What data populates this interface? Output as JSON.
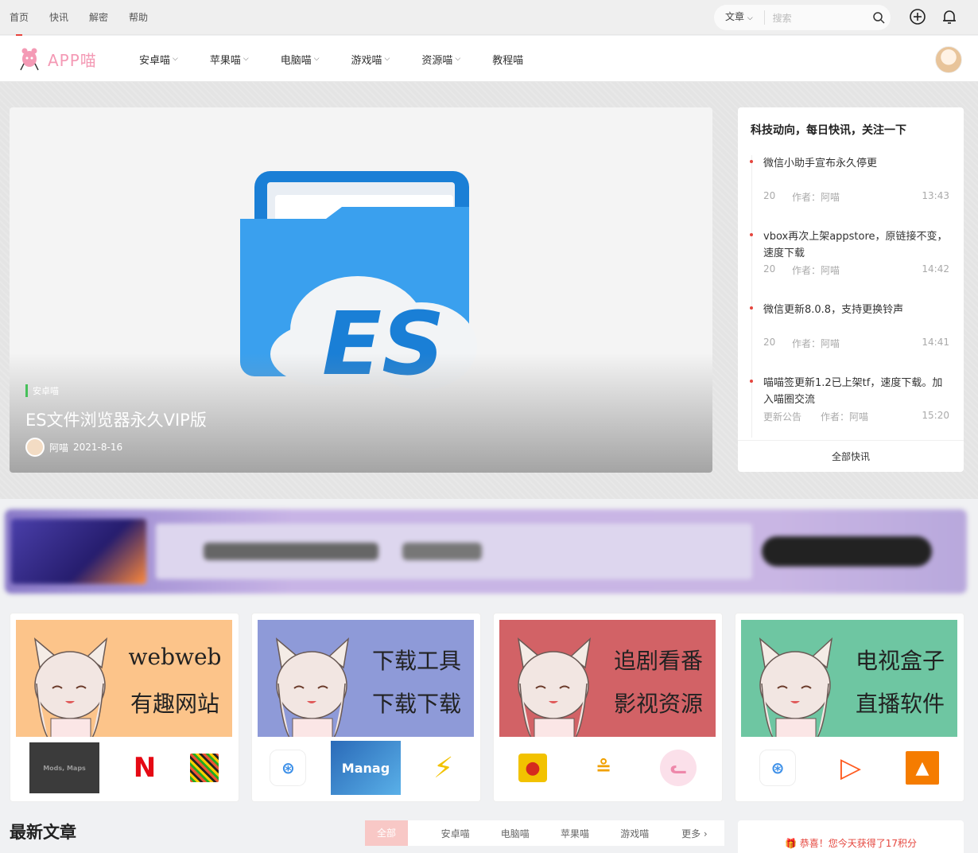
{
  "topbar": {
    "links": [
      "首页",
      "快讯",
      "解密",
      "帮助"
    ],
    "search_select": "文章",
    "search_placeholder": "搜索"
  },
  "nav": {
    "logo": "APP喵",
    "items": [
      {
        "label": "安卓喵",
        "dropdown": true
      },
      {
        "label": "苹果喵",
        "dropdown": true
      },
      {
        "label": "电脑喵",
        "dropdown": true
      },
      {
        "label": "游戏喵",
        "dropdown": true
      },
      {
        "label": "资源喵",
        "dropdown": true
      },
      {
        "label": "教程喵",
        "dropdown": false
      }
    ]
  },
  "hero": {
    "category": "安卓喵",
    "title": "ES文件浏览器永久VIP版",
    "author": "阿喵",
    "date": "2021-8-16"
  },
  "news": {
    "heading": "科技动向，每日快讯，关注一下",
    "items": [
      {
        "title": "微信小助手宣布永久停更",
        "cat": "20",
        "author": "作者：阿喵",
        "time": "13:43"
      },
      {
        "title": "vbox再次上架appstore，原链接不变，速度下载",
        "cat": "20",
        "author": "作者：阿喵",
        "time": "14:42"
      },
      {
        "title": "微信更新8.0.8，支持更换铃声",
        "cat": "20",
        "author": "作者：阿喵",
        "time": "14:41"
      },
      {
        "title": "喵喵签更新1.2已上架tf，速度下载。加入喵圈交流",
        "cat": "更新公告",
        "author": "作者：阿喵",
        "time": "15:20"
      }
    ],
    "all_label": "全部快讯"
  },
  "cards": [
    {
      "line1": "webweb",
      "line2": "有趣网站",
      "bg": "#fcc48a"
    },
    {
      "line1": "下载工具",
      "line2": "下载下载",
      "bg": "#8e9ad8"
    },
    {
      "line1": "追剧看番",
      "line2": "影视资源",
      "bg": "#d26266"
    },
    {
      "line1": "电视盒子",
      "line2": "直播软件",
      "bg": "#6ec6a2"
    }
  ],
  "latest": {
    "heading": "最新文章",
    "tabs": [
      "全部",
      "安卓喵",
      "电脑喵",
      "苹果喵",
      "游戏喵",
      "更多"
    ]
  },
  "bonus": "恭喜！您今天获得了17积分"
}
